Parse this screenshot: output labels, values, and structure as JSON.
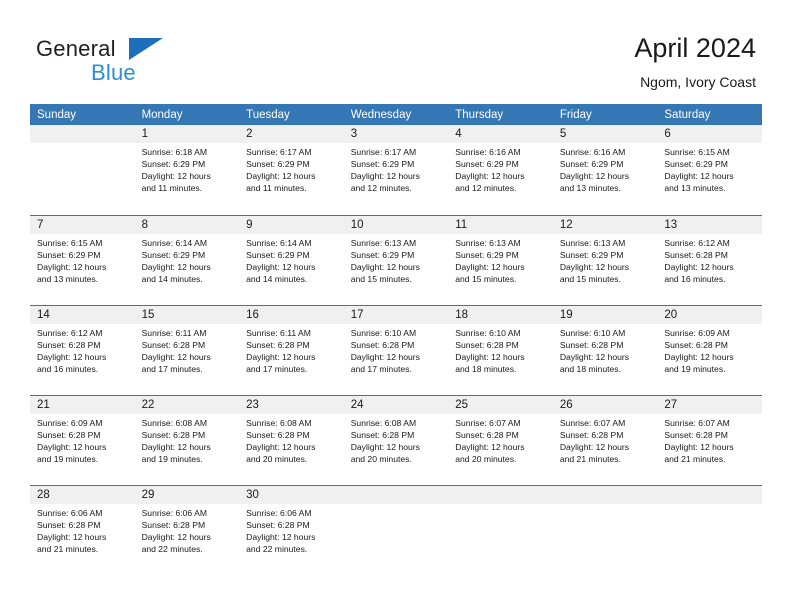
{
  "brand": {
    "name_dark": "General",
    "name_blue": "Blue",
    "accent_blue": "#3576b5",
    "logo_blue": "#2b8ed6"
  },
  "header": {
    "title": "April 2024",
    "subtitle": "Ngom, Ivory Coast"
  },
  "weekday_headers": [
    "Sunday",
    "Monday",
    "Tuesday",
    "Wednesday",
    "Thursday",
    "Friday",
    "Saturday"
  ],
  "labels": {
    "sunrise_prefix": "Sunrise:",
    "sunset_prefix": "Sunset:",
    "daylight_prefix": "Daylight:"
  },
  "weeks": [
    [
      {
        "day": "",
        "blank": true
      },
      {
        "day": "1",
        "sunrise": "Sunrise: 6:18 AM",
        "sunset": "Sunset: 6:29 PM",
        "daylight_a": "Daylight: 12 hours",
        "daylight_b": "and 11 minutes."
      },
      {
        "day": "2",
        "sunrise": "Sunrise: 6:17 AM",
        "sunset": "Sunset: 6:29 PM",
        "daylight_a": "Daylight: 12 hours",
        "daylight_b": "and 11 minutes."
      },
      {
        "day": "3",
        "sunrise": "Sunrise: 6:17 AM",
        "sunset": "Sunset: 6:29 PM",
        "daylight_a": "Daylight: 12 hours",
        "daylight_b": "and 12 minutes."
      },
      {
        "day": "4",
        "sunrise": "Sunrise: 6:16 AM",
        "sunset": "Sunset: 6:29 PM",
        "daylight_a": "Daylight: 12 hours",
        "daylight_b": "and 12 minutes."
      },
      {
        "day": "5",
        "sunrise": "Sunrise: 6:16 AM",
        "sunset": "Sunset: 6:29 PM",
        "daylight_a": "Daylight: 12 hours",
        "daylight_b": "and 13 minutes."
      },
      {
        "day": "6",
        "sunrise": "Sunrise: 6:15 AM",
        "sunset": "Sunset: 6:29 PM",
        "daylight_a": "Daylight: 12 hours",
        "daylight_b": "and 13 minutes."
      }
    ],
    [
      {
        "day": "7",
        "sunrise": "Sunrise: 6:15 AM",
        "sunset": "Sunset: 6:29 PM",
        "daylight_a": "Daylight: 12 hours",
        "daylight_b": "and 13 minutes."
      },
      {
        "day": "8",
        "sunrise": "Sunrise: 6:14 AM",
        "sunset": "Sunset: 6:29 PM",
        "daylight_a": "Daylight: 12 hours",
        "daylight_b": "and 14 minutes."
      },
      {
        "day": "9",
        "sunrise": "Sunrise: 6:14 AM",
        "sunset": "Sunset: 6:29 PM",
        "daylight_a": "Daylight: 12 hours",
        "daylight_b": "and 14 minutes."
      },
      {
        "day": "10",
        "sunrise": "Sunrise: 6:13 AM",
        "sunset": "Sunset: 6:29 PM",
        "daylight_a": "Daylight: 12 hours",
        "daylight_b": "and 15 minutes."
      },
      {
        "day": "11",
        "sunrise": "Sunrise: 6:13 AM",
        "sunset": "Sunset: 6:29 PM",
        "daylight_a": "Daylight: 12 hours",
        "daylight_b": "and 15 minutes."
      },
      {
        "day": "12",
        "sunrise": "Sunrise: 6:13 AM",
        "sunset": "Sunset: 6:29 PM",
        "daylight_a": "Daylight: 12 hours",
        "daylight_b": "and 15 minutes."
      },
      {
        "day": "13",
        "sunrise": "Sunrise: 6:12 AM",
        "sunset": "Sunset: 6:28 PM",
        "daylight_a": "Daylight: 12 hours",
        "daylight_b": "and 16 minutes."
      }
    ],
    [
      {
        "day": "14",
        "sunrise": "Sunrise: 6:12 AM",
        "sunset": "Sunset: 6:28 PM",
        "daylight_a": "Daylight: 12 hours",
        "daylight_b": "and 16 minutes."
      },
      {
        "day": "15",
        "sunrise": "Sunrise: 6:11 AM",
        "sunset": "Sunset: 6:28 PM",
        "daylight_a": "Daylight: 12 hours",
        "daylight_b": "and 17 minutes."
      },
      {
        "day": "16",
        "sunrise": "Sunrise: 6:11 AM",
        "sunset": "Sunset: 6:28 PM",
        "daylight_a": "Daylight: 12 hours",
        "daylight_b": "and 17 minutes."
      },
      {
        "day": "17",
        "sunrise": "Sunrise: 6:10 AM",
        "sunset": "Sunset: 6:28 PM",
        "daylight_a": "Daylight: 12 hours",
        "daylight_b": "and 17 minutes."
      },
      {
        "day": "18",
        "sunrise": "Sunrise: 6:10 AM",
        "sunset": "Sunset: 6:28 PM",
        "daylight_a": "Daylight: 12 hours",
        "daylight_b": "and 18 minutes."
      },
      {
        "day": "19",
        "sunrise": "Sunrise: 6:10 AM",
        "sunset": "Sunset: 6:28 PM",
        "daylight_a": "Daylight: 12 hours",
        "daylight_b": "and 18 minutes."
      },
      {
        "day": "20",
        "sunrise": "Sunrise: 6:09 AM",
        "sunset": "Sunset: 6:28 PM",
        "daylight_a": "Daylight: 12 hours",
        "daylight_b": "and 19 minutes."
      }
    ],
    [
      {
        "day": "21",
        "sunrise": "Sunrise: 6:09 AM",
        "sunset": "Sunset: 6:28 PM",
        "daylight_a": "Daylight: 12 hours",
        "daylight_b": "and 19 minutes."
      },
      {
        "day": "22",
        "sunrise": "Sunrise: 6:08 AM",
        "sunset": "Sunset: 6:28 PM",
        "daylight_a": "Daylight: 12 hours",
        "daylight_b": "and 19 minutes."
      },
      {
        "day": "23",
        "sunrise": "Sunrise: 6:08 AM",
        "sunset": "Sunset: 6:28 PM",
        "daylight_a": "Daylight: 12 hours",
        "daylight_b": "and 20 minutes."
      },
      {
        "day": "24",
        "sunrise": "Sunrise: 6:08 AM",
        "sunset": "Sunset: 6:28 PM",
        "daylight_a": "Daylight: 12 hours",
        "daylight_b": "and 20 minutes."
      },
      {
        "day": "25",
        "sunrise": "Sunrise: 6:07 AM",
        "sunset": "Sunset: 6:28 PM",
        "daylight_a": "Daylight: 12 hours",
        "daylight_b": "and 20 minutes."
      },
      {
        "day": "26",
        "sunrise": "Sunrise: 6:07 AM",
        "sunset": "Sunset: 6:28 PM",
        "daylight_a": "Daylight: 12 hours",
        "daylight_b": "and 21 minutes."
      },
      {
        "day": "27",
        "sunrise": "Sunrise: 6:07 AM",
        "sunset": "Sunset: 6:28 PM",
        "daylight_a": "Daylight: 12 hours",
        "daylight_b": "and 21 minutes."
      }
    ],
    [
      {
        "day": "28",
        "sunrise": "Sunrise: 6:06 AM",
        "sunset": "Sunset: 6:28 PM",
        "daylight_a": "Daylight: 12 hours",
        "daylight_b": "and 21 minutes."
      },
      {
        "day": "29",
        "sunrise": "Sunrise: 6:06 AM",
        "sunset": "Sunset: 6:28 PM",
        "daylight_a": "Daylight: 12 hours",
        "daylight_b": "and 22 minutes."
      },
      {
        "day": "30",
        "sunrise": "Sunrise: 6:06 AM",
        "sunset": "Sunset: 6:28 PM",
        "daylight_a": "Daylight: 12 hours",
        "daylight_b": "and 22 minutes."
      },
      {
        "day": "",
        "blank": true
      },
      {
        "day": "",
        "blank": true
      },
      {
        "day": "",
        "blank": true
      },
      {
        "day": "",
        "blank": true
      }
    ]
  ]
}
